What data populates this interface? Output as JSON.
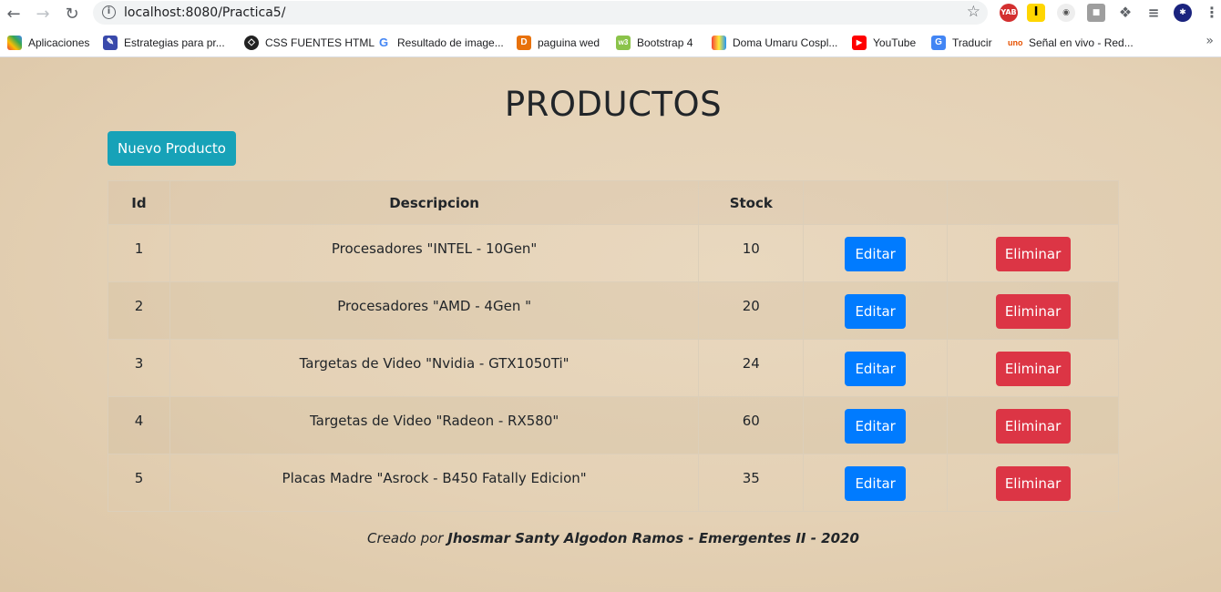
{
  "browser": {
    "url": "localhost:8080/Practica5/"
  },
  "bookmarks": [
    {
      "label": "Aplicaciones",
      "icon": "apps-grid-icon"
    },
    {
      "label": "Estrategias para pr...",
      "icon": "strategy-icon"
    },
    {
      "label": "CSS FUENTES HTML",
      "icon": "codepen-icon"
    },
    {
      "label": "Resultado de image...",
      "icon": "google-icon"
    },
    {
      "label": "paguina wed",
      "icon": "d-letter-icon"
    },
    {
      "label": "Bootstrap 4",
      "icon": "w3-icon"
    },
    {
      "label": "Doma Umaru Cospl...",
      "icon": "shopping-bag-icon"
    },
    {
      "label": "YouTube",
      "icon": "youtube-icon"
    },
    {
      "label": "Traducir",
      "icon": "translate-icon"
    },
    {
      "label": "Señal en vivo - Red...",
      "icon": "uno-icon"
    }
  ],
  "extensions": {
    "yab": "YAB"
  },
  "page": {
    "title": "PRODUCTOS",
    "new_button": "Nuevo Producto",
    "table": {
      "headers": [
        "Id",
        "Descripcion",
        "Stock",
        "",
        ""
      ],
      "rows": [
        {
          "id": "1",
          "descripcion": "Procesadores \"INTEL - 10Gen\"",
          "stock": "10"
        },
        {
          "id": "2",
          "descripcion": "Procesadores \"AMD - 4Gen \"",
          "stock": "20"
        },
        {
          "id": "3",
          "descripcion": "Targetas de Video \"Nvidia - GTX1050Ti\"",
          "stock": "24"
        },
        {
          "id": "4",
          "descripcion": "Targetas de Video \"Radeon - RX580\"",
          "stock": "60"
        },
        {
          "id": "5",
          "descripcion": "Placas Madre \"Asrock - B450 Fatally Edicion\"",
          "stock": "35"
        }
      ],
      "edit_label": "Editar",
      "delete_label": "Eliminar"
    },
    "footer_prefix": "Creado por",
    "footer_author": "Jhosmar Santy Algodon Ramos - Emergentes II - 2020"
  },
  "colors": {
    "info": "#17a2b8",
    "primary": "#007bff",
    "danger": "#dc3545"
  }
}
